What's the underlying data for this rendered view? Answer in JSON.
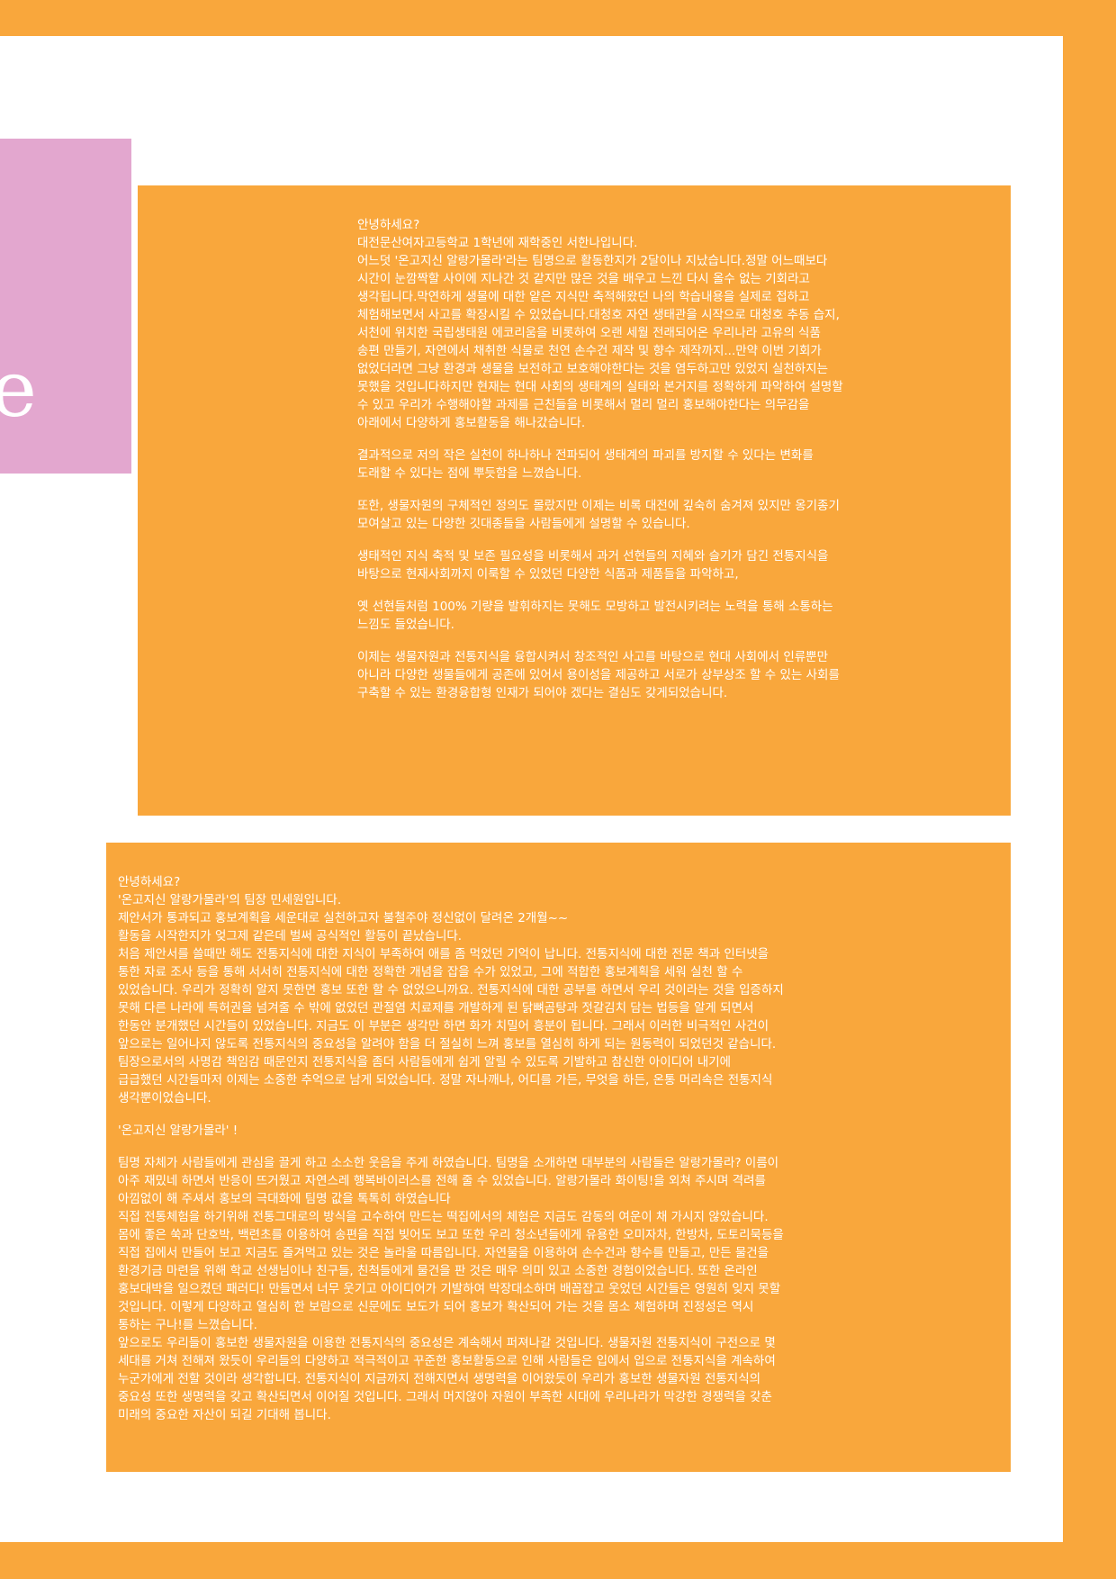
{
  "decoration": {
    "pink_glyph": "e"
  },
  "letter_top": {
    "paragraphs": [
      [
        "안녕하세요?",
        " 대전문산여자고등학교 1학년에 재학중인 서한나입니다.",
        "어느덧 '온고지신 알랑가몰라'라는 팀명으로 활동한지가 2달이나 지났습니다.정말 어느때보다",
        "시간이 눈깜짝할 사이에 지나간 것 같지만 많은 것을 배우고 느낀 다시 올수 없는 기회라고",
        "생각됩니다.막연하게 생물에 대한 얕은 지식만 축적해왔던 나의 학습내용을 실제로 접하고",
        "체험해보면서 사고를 확장시킬 수 있었습니다.대청호 자연 생태관을 시작으로 대청호 추동 습지,",
        "서천에 위치한 국립생태원 에코리움을 비롯하여 오랜 세월 전래되어온 우리나라 고유의 식품",
        "송편 만들기, 자연에서 채취한 식물로 천연 손수건 제작 및 향수 제작까지...만약 이번 기회가",
        "없었더라면 그냥 환경과 생물을 보전하고 보호해야한다는 것을 염두하고만 있었지 실천하지는",
        "못했을 것입니다하지만 현재는 현대 사회의 생태계의 실태와 본거지를 정확하게 파악하여 설명할",
        "수 있고 우리가 수행해야할 과제를 근친들을 비롯해서 멀리 멀리 홍보해야한다는 의무감을",
        "아래에서 다양하게 홍보활동을 해나갔습니다."
      ],
      [
        "결과적으로 저의 작은 실천이 하나하나 전파되어 생태계의 파괴를 방지할 수 있다는 변화를",
        "도래할 수 있다는 점에 뿌듯함을 느꼈습니다."
      ],
      [
        "또한, 생물자원의 구체적인 정의도 몰랐지만 이제는 비록 대전에 깊숙히 숨겨져 있지만 옹기종기",
        "모여살고 있는 다양한 깃대종들을 사람들에게 설명할 수 있습니다."
      ],
      [
        "생태적인 지식 축적 및 보존 필요성을 비롯해서 과거 선현들의 지혜와 슬기가 담긴 전통지식을",
        "바탕으로 현재사회까지 이룩할 수 있었던 다양한 식품과 제품들을 파악하고,"
      ],
      [
        "옛 선현들처럼 100% 기량을 발휘하지는 못해도 모방하고 발전시키려는 노력을 통해 소통하는",
        "느낌도 들었습니다."
      ],
      [
        "이제는 생물자원과 전통지식을 융합시켜서 창조적인 사고를 바탕으로 현대 사회에서 인류뿐만",
        "아니라 다양한 생물들에게 공존에 있어서 용이성을 제공하고 서로가 상부상조 할 수 있는 사회를",
        "구축할 수 있는 환경융합형 인재가 되어야 겠다는 결심도 갖게되었습니다."
      ]
    ]
  },
  "letter_bottom": {
    "paragraphs": [
      [
        "안녕하세요?",
        "'온고지신 알랑가몰라'의 팀장 민세원입니다.",
        "제안서가 통과되고 홍보계획을 세운대로 실천하고자 불철주야 정신없이 달려온 2개월~~",
        "활동을 시작한지가 엊그제 같은데 벌써 공식적인 활동이 끝났습니다.",
        "처음 제안서를 쓸때만 해도 전통지식에 대한 지식이 부족하여 애를 좀 먹었던 기억이 납니다. 전통지식에 대한 전문 책과 인터넷을",
        "통한 자료 조사 등을 통해 서서히 전통지식에 대한 정확한 개념을 잡을 수가 있었고, 그에 적합한 홍보계획을 세워 실천 할 수",
        "있었습니다. 우리가 정확히 알지 못한면 홍보 또한 할 수 없었으니까요. 전통지식에 대한 공부를 하면서 우리 것이라는 것을 입증하지",
        "못해 다른 나라에 특허권을 넘겨줄 수 밖에 없었던 관절염 치료제를 개발하게 된 닭뼈곰탕과 젓갈김치 담는 법등을 알게 되면서",
        "한동안 분개했던 시간들이 있었습니다. 지금도 이 부분은 생각만 하면 화가 치밀어 흥분이 됩니다. 그래서 이러한 비극적인 사건이",
        "앞으로는 일어나지 않도록 전통지식의 중요성을 알려야 함을 더 절실히 느껴 홍보를 열심히 하게 되는 원동력이 되었던것 같습니다.",
        "팀장으로서의 사명감 책임감 때문인지 전통지식을 좀더 사람들에게 쉽게 알릴 수 있도록 기발하고 참신한 아이디어 내기에",
        "급급했던 시간들마저 이제는 소중한 추억으로 남게 되었습니다. 정말 자나깨나, 어디를 가든, 무엇을 하든, 온통 머리속은 전통지식",
        "생각뿐이었습니다."
      ],
      [
        "  '온고지신 알랑가몰라' !"
      ],
      [
        "팀명 자체가 사람들에게 관심을 끌게 하고 소소한 웃음을 주게 하였습니다. 팀명을 소개하면 대부분의 사람들은 알랑가몰라? 이름이",
        "아주 재밌네 하면서 반응이 뜨거웠고 자연스레 행복바이러스를 전해 줄 수 있었습니다. 알랑가몰라 화이팅!을 외쳐 주시며 격려를",
        "아낌없이 해 주셔서 홍보의 극대화에 팀명 값을 톡톡히 하였습니다",
        "직접 전통체험을 하기위해 전통그대로의 방식을 고수하여 만드는 떡집에서의 체험은 지금도 감동의 여운이 채 가시지 않았습니다.",
        "몸에 좋은 쑥과 단호박, 백련초를 이용하여 송편을 직접 빚어도 보고 또한 우리 청소년들에게 유용한 오미자차, 한방차, 도토리묵등을",
        "직접 집에서 만들어 보고 지금도 즐겨먹고 있는 것은 놀라울 따름입니다. 자연물을 이용하여 손수건과 향수를 만들고, 만든 물건을",
        "환경기금 마련을 위해 학교 선생님이나 친구들, 친척들에게 물건을 판 것은 매우 의미 있고 소중한 경험이었습니다. 또한 온라인",
        "홍보대박을 일으켰던 패러디! 만들면서 너무 웃기고 아이디어가 기발하여  박장대소하며 배꼽잡고 웃었던 시간들은 영원히 잊지 못할",
        "것입니다.  이렇게 다양하고 열심히 한 보람으로 신문에도 보도가 되어 홍보가 확산되어 가는 것을 몸소 체험하며 진정성은 역시",
        "통하는 구나!를  느꼈습니다.",
        "앞으로도 우리들이 홍보한 생물자원을 이용한 전통지식의 중요성은 계속해서 퍼져나갈 것입니다. 생물자원 전통지식이 구전으로 몇",
        "세대를 거쳐 전해져 왔듯이 우리들의 다양하고 적극적이고 꾸준한 홍보활동으로 인해 사람들은 입에서 입으로 전통지식을 계속하여",
        "누군가에게 전할 것이라 생각합니다. 전통지식이 지금까지 전해지면서 생명력을 이어왔듯이 우리가 홍보한 생물자원 전통지식의",
        "중요성 또한 생명력을 갖고 확산되면서 이어질 것입니다. 그래서 머지않아 자원이 부족한 시대에 우리나라가 막강한 경쟁력을 갖춘",
        "미래의 중요한 자산이 되길 기대해 봅니다."
      ]
    ]
  },
  "colors": {
    "orange": "#f9a73c",
    "pink": "#e3a7cf",
    "white": "#ffffff"
  }
}
